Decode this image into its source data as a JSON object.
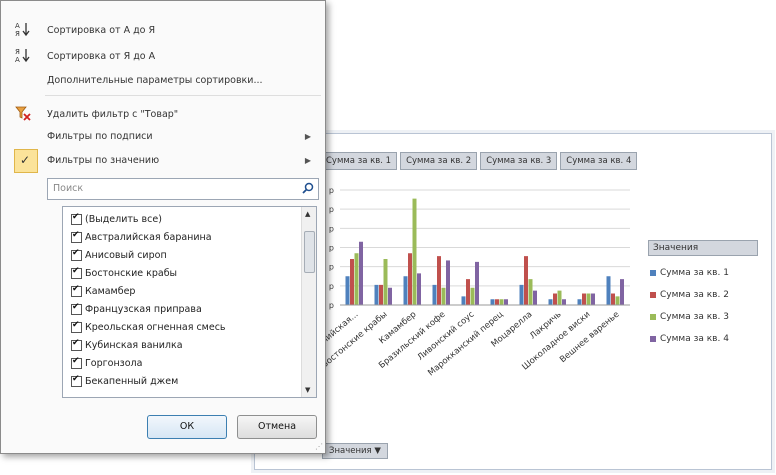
{
  "menu": {
    "sort_asc": "Сортировка от А до Я",
    "sort_desc": "Сортировка от Я до А",
    "more_sort": "Дополнительные параметры сортировки...",
    "clear_filter": "Удалить фильтр с \"Товар\"",
    "label_filters": "Фильтры по подписи",
    "value_filters": "Фильтры по значению",
    "search_placeholder": "Поиск",
    "ok": "ОК",
    "cancel": "Отмена"
  },
  "values_list": [
    "(Выделить все)",
    "Австралийская баранина",
    "Анисовый сироп",
    "Бостонские крабы",
    "Камамбер",
    "Французская приправа",
    "Креольская огненная смесь",
    "Кубинская ванилка",
    "Горгонзола",
    "Бекапенный джем"
  ],
  "chart_buttons": [
    "Сумма за кв. 1",
    "Сумма за кв. 2",
    "Сумма за кв. 3",
    "Сумма за кв. 4"
  ],
  "legend": {
    "title": "Значения",
    "items": [
      {
        "label": "Сумма за кв. 1",
        "color": "#4f81bd"
      },
      {
        "label": "Сумма за кв. 2",
        "color": "#c0504d"
      },
      {
        "label": "Сумма за кв. 3",
        "color": "#9bbb59"
      },
      {
        "label": "Сумма за кв. 4",
        "color": "#8064a2"
      }
    ]
  },
  "value_button": "Значения",
  "chart_data": {
    "type": "bar",
    "categories": [
      "Австралийская...",
      "Бостонские крабы",
      "Камамбер",
      "Бразильский кофе",
      "Ливонский соус",
      "Марокканский перец",
      "Моцарелла",
      "Лакричь",
      "Шоколадное виски",
      "Вешнее варенье"
    ],
    "series": [
      {
        "name": "Сумма за кв. 1",
        "values": [
          2,
          1.4,
          2,
          1.4,
          0.6,
          0.4,
          1.4,
          0.4,
          0.4,
          2
        ]
      },
      {
        "name": "Сумма за кв. 2",
        "values": [
          3.2,
          1.4,
          3.6,
          3.4,
          1.8,
          0.4,
          3.4,
          0.8,
          0.8,
          0.8
        ]
      },
      {
        "name": "Сумма за кв. 3",
        "values": [
          3.6,
          3.2,
          7.4,
          1.2,
          1.2,
          0.4,
          1.8,
          1,
          0.8,
          0.6
        ]
      },
      {
        "name": "Сумма за кв. 4",
        "values": [
          4.4,
          1.2,
          2.2,
          3.1,
          3.0,
          0.4,
          1.0,
          0.4,
          0.8,
          1.8
        ]
      }
    ],
    "ylim": [
      0,
      8
    ]
  }
}
